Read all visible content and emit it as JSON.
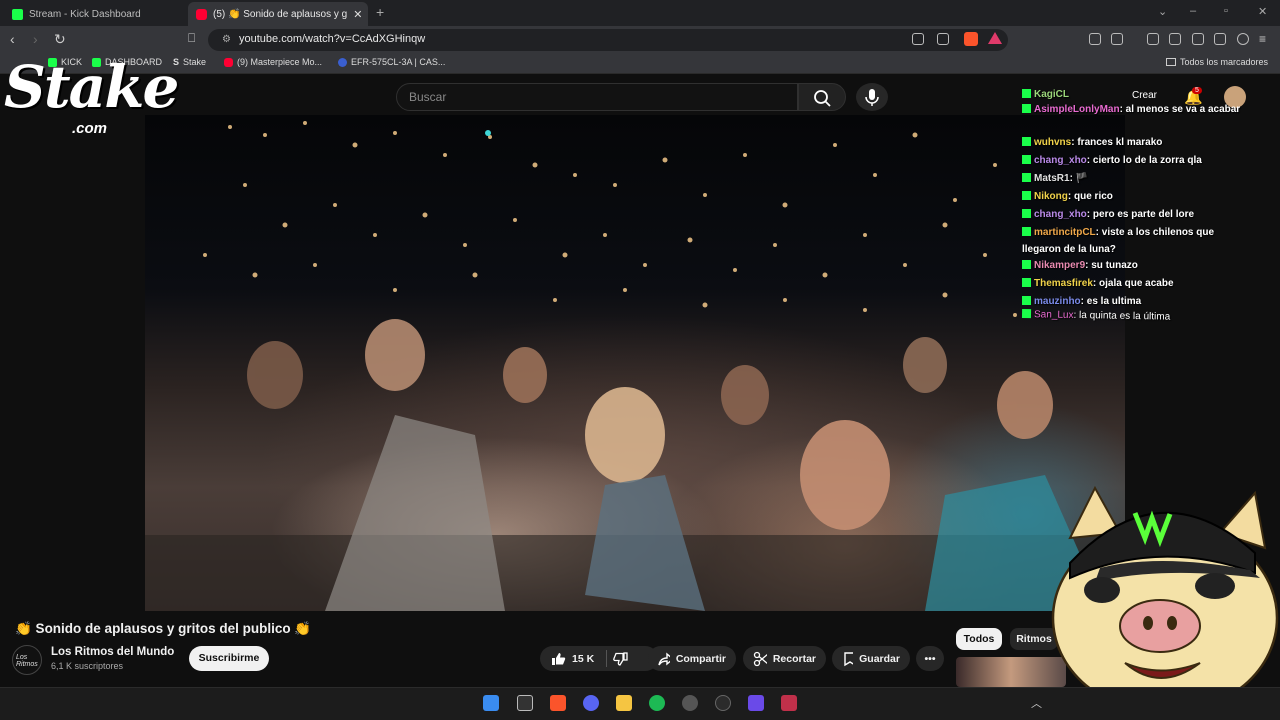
{
  "browser": {
    "tabs": [
      {
        "label": "Stream - Kick Dashboard",
        "icon": "kick-icon"
      },
      {
        "label": "(5) 👏 Sonido de aplausos y g",
        "icon": "youtube-icon",
        "active": true
      }
    ],
    "url": "youtube.com/watch?v=CcAdXGHinqw",
    "bookmarks": [
      {
        "label": "KICK",
        "icon": "kick-icon"
      },
      {
        "label": "DASHBOARD",
        "icon": "kick-icon"
      },
      {
        "label": "Stake",
        "icon": "stake-icon"
      },
      {
        "label": "(9) Masterpiece Mo...",
        "icon": "youtube-icon"
      },
      {
        "label": "EFR-575CL-3A | CAS...",
        "icon": "casio-icon"
      }
    ],
    "all_bookmarks": "Todos los marcadores"
  },
  "youtube": {
    "search_placeholder": "Buscar",
    "create_label": "Crear",
    "notification_count": "5",
    "video_title": "👏 Sonido de aplausos y gritos del publico 👏",
    "channel_name": "Los Ritmos del Mundo",
    "channel_avatar_text": "Los Ritmos",
    "subscribers": "6,1 K suscriptores",
    "subscribe_label": "Suscribirme",
    "likes": "15 K",
    "share_label": "Compartir",
    "clip_label": "Recortar",
    "save_label": "Guardar",
    "chips": [
      "Todos",
      "Ritmos"
    ]
  },
  "overlay": {
    "logo": "Stake",
    "logo_suffix": ".com",
    "chat": [
      {
        "user": "KagiCL",
        "text": "",
        "color": "#9bd67a"
      },
      {
        "user": "AsimpleLonlyMan",
        "text": ": al menos se va a acabar",
        "color": "#e86bd0"
      },
      {
        "user": "wuhvns",
        "text": ": frances kl marako",
        "color": "#f0d24a"
      },
      {
        "user": "chang_xho",
        "text": ": cierto lo de la zorra qla",
        "color": "#b98ae8"
      },
      {
        "user": "MatsR1",
        "text": ": 🏴",
        "color": "#e0e0e0"
      },
      {
        "user": "Nikong",
        "text": ": que rico",
        "color": "#f0d24a"
      },
      {
        "user": "chang_xho",
        "text": ": pero es parte del lore",
        "color": "#b98ae8"
      },
      {
        "user": "martincitpCL",
        "text": ": viste a los chilenos que llegaron de la luna?",
        "color": "#f0a84a"
      },
      {
        "user": "Nikamper9",
        "text": ": su tunazo",
        "color": "#e88ab0"
      },
      {
        "user": "Themasfirek",
        "text": ": ojala que acabe",
        "color": "#f0d24a"
      },
      {
        "user": "mauzinho",
        "text": ": es la ultima",
        "color": "#7a8ae8"
      },
      {
        "user": "San_Lux",
        "text": ": la quinta es la última",
        "color": "#e86bd0"
      }
    ]
  },
  "colors": {
    "kick_green": "#1aff4a",
    "youtube_red": "#ff0033",
    "background": "#0f0f0f"
  }
}
